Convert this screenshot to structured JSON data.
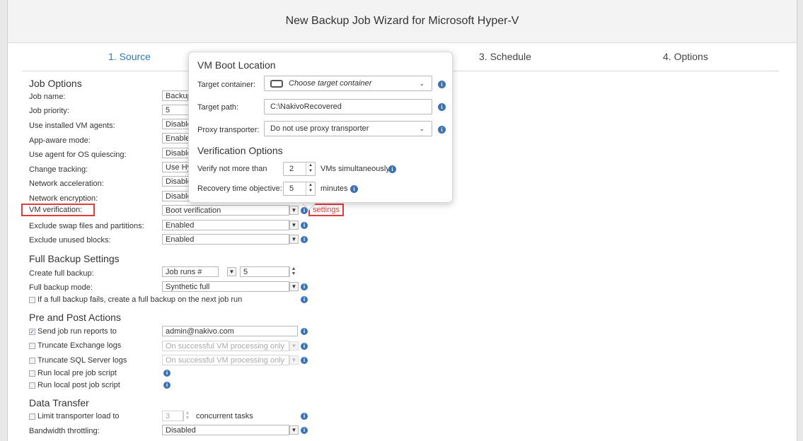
{
  "title": "New Backup Job Wizard for Microsoft Hyper-V",
  "tabs": [
    "1. Source",
    "3. Schedule",
    "4. Options"
  ],
  "job_options": {
    "heading": "Job Options",
    "rows": [
      {
        "label": "Job name:",
        "value": "Backup"
      },
      {
        "label": "Job priority:",
        "value": "5"
      },
      {
        "label": "Use installed VM agents:",
        "value": "Disable"
      },
      {
        "label": "App-aware mode:",
        "value": "Enable"
      },
      {
        "label": "Use agent for OS quiescing:",
        "value": "Disable"
      },
      {
        "label": "Change tracking:",
        "value": "Use Hy"
      },
      {
        "label": "Network acceleration:",
        "value": "Disable"
      },
      {
        "label": "Network encryption:",
        "value": "Disable"
      },
      {
        "label": "VM verification:",
        "value": "Boot verification"
      },
      {
        "label": "Exclude swap files and partitions:",
        "value": "Enabled"
      },
      {
        "label": "Exclude unused blocks:",
        "value": "Enabled"
      }
    ],
    "settings_link": "settings"
  },
  "full_backup": {
    "heading": "Full Backup Settings",
    "create_label": "Create full backup:",
    "create_mode": "Job runs #",
    "create_count": "5",
    "mode_label": "Full backup mode:",
    "mode_value": "Synthetic full",
    "fail_checkbox_label": "If a full backup fails, create a full backup on the next job run"
  },
  "pre_post": {
    "heading": "Pre and Post Actions",
    "send_reports_label": "Send job run reports to",
    "send_reports_email": "admin@nakivo.com",
    "truncate_exchange_label": "Truncate Exchange logs",
    "truncate_exchange_value": "On successful VM processing only",
    "truncate_sql_label": "Truncate SQL Server logs",
    "truncate_sql_value": "On successful VM processing only",
    "pre_script_label": "Run local pre job script",
    "post_script_label": "Run local post job script"
  },
  "data_transfer": {
    "heading": "Data Transfer",
    "limit_label": "Limit transporter load to",
    "limit_value": "3",
    "limit_suffix": "concurrent tasks",
    "bandwidth_label": "Bandwidth throttling:",
    "bandwidth_value": "Disabled"
  },
  "popup": {
    "heading": "VM Boot Location",
    "target_container_label": "Target container:",
    "target_container_value": "Choose target container",
    "target_path_label": "Target path:",
    "target_path_value": "C:\\NakivoRecovered",
    "proxy_label": "Proxy transporter:",
    "proxy_value": "Do not use proxy transporter",
    "verification_heading": "Verification Options",
    "verify_label": "Verify not more than",
    "verify_value": "2",
    "verify_suffix": "VMs simultaneously",
    "rto_label": "Recovery time objective:",
    "rto_value": "5",
    "rto_suffix": "minutes"
  },
  "colors": {
    "accent": "#2b7bb9",
    "highlight": "#e33b3b",
    "info": "#3a73b5"
  },
  "icons": {
    "info": "info-icon",
    "dropdown": "chevron-down-icon",
    "container": "storage-icon"
  }
}
